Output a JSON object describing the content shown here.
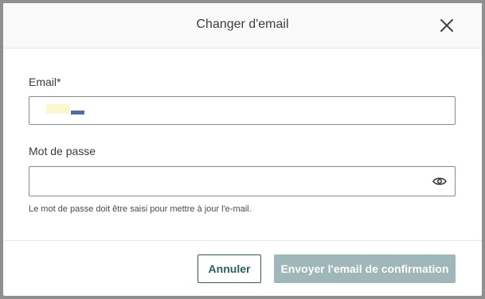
{
  "dialog": {
    "title": "Changer d'email",
    "close_icon": "close-icon"
  },
  "form": {
    "email_label": "Email*",
    "email_value": "",
    "password_label": "Mot de passe",
    "password_value": "",
    "password_toggle_icon": "eye-icon",
    "help_text": "Le mot de passe doit être saisi pour mettre à jour l'e-mail."
  },
  "actions": {
    "cancel_label": "Annuler",
    "send_label": "Envoyer l'email de confirmation"
  },
  "colors": {
    "primary": "#2b5f5c",
    "disabled_button": "#9fb7b9",
    "header_bg": "#f9f9f9"
  }
}
